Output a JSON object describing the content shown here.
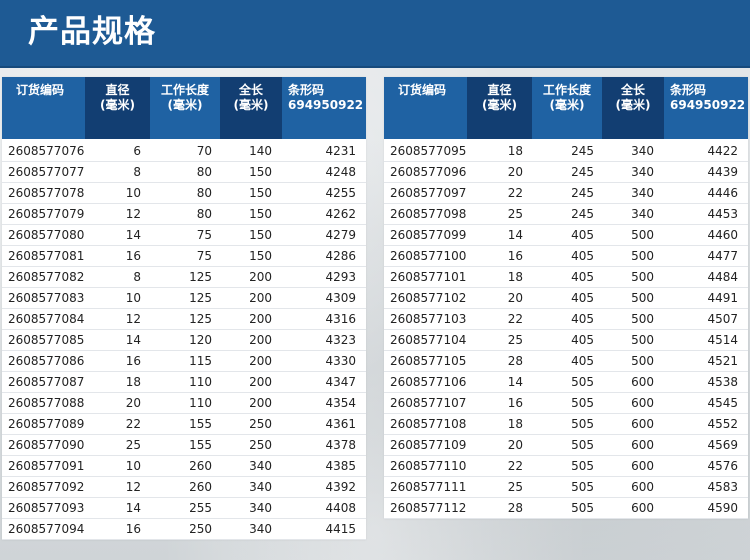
{
  "header": {
    "title": "产品规格"
  },
  "columns": {
    "order": "订货编码",
    "diameter": [
      "直径",
      "(毫米)"
    ],
    "work_length": [
      "工作长度",
      "(毫米)"
    ],
    "total_length": [
      "全长",
      "(毫米)"
    ],
    "barcode": [
      "条形码",
      "694950922"
    ]
  },
  "colors": {
    "header_bg": "#1e5a94",
    "col_light": "#1f62a3",
    "col_dark": "#123e72"
  },
  "tables": {
    "left": [
      [
        "2608577076",
        "6",
        "70",
        "140",
        "4231"
      ],
      [
        "2608577077",
        "8",
        "80",
        "150",
        "4248"
      ],
      [
        "2608577078",
        "10",
        "80",
        "150",
        "4255"
      ],
      [
        "2608577079",
        "12",
        "80",
        "150",
        "4262"
      ],
      [
        "2608577080",
        "14",
        "75",
        "150",
        "4279"
      ],
      [
        "2608577081",
        "16",
        "75",
        "150",
        "4286"
      ],
      [
        "2608577082",
        "8",
        "125",
        "200",
        "4293"
      ],
      [
        "2608577083",
        "10",
        "125",
        "200",
        "4309"
      ],
      [
        "2608577084",
        "12",
        "125",
        "200",
        "4316"
      ],
      [
        "2608577085",
        "14",
        "120",
        "200",
        "4323"
      ],
      [
        "2608577086",
        "16",
        "115",
        "200",
        "4330"
      ],
      [
        "2608577087",
        "18",
        "110",
        "200",
        "4347"
      ],
      [
        "2608577088",
        "20",
        "110",
        "200",
        "4354"
      ],
      [
        "2608577089",
        "22",
        "155",
        "250",
        "4361"
      ],
      [
        "2608577090",
        "25",
        "155",
        "250",
        "4378"
      ],
      [
        "2608577091",
        "10",
        "260",
        "340",
        "4385"
      ],
      [
        "2608577092",
        "12",
        "260",
        "340",
        "4392"
      ],
      [
        "2608577093",
        "14",
        "255",
        "340",
        "4408"
      ],
      [
        "2608577094",
        "16",
        "250",
        "340",
        "4415"
      ]
    ],
    "right": [
      [
        "2608577095",
        "18",
        "245",
        "340",
        "4422"
      ],
      [
        "2608577096",
        "20",
        "245",
        "340",
        "4439"
      ],
      [
        "2608577097",
        "22",
        "245",
        "340",
        "4446"
      ],
      [
        "2608577098",
        "25",
        "245",
        "340",
        "4453"
      ],
      [
        "2608577099",
        "14",
        "405",
        "500",
        "4460"
      ],
      [
        "2608577100",
        "16",
        "405",
        "500",
        "4477"
      ],
      [
        "2608577101",
        "18",
        "405",
        "500",
        "4484"
      ],
      [
        "2608577102",
        "20",
        "405",
        "500",
        "4491"
      ],
      [
        "2608577103",
        "22",
        "405",
        "500",
        "4507"
      ],
      [
        "2608577104",
        "25",
        "405",
        "500",
        "4514"
      ],
      [
        "2608577105",
        "28",
        "405",
        "500",
        "4521"
      ],
      [
        "2608577106",
        "14",
        "505",
        "600",
        "4538"
      ],
      [
        "2608577107",
        "16",
        "505",
        "600",
        "4545"
      ],
      [
        "2608577108",
        "18",
        "505",
        "600",
        "4552"
      ],
      [
        "2608577109",
        "20",
        "505",
        "600",
        "4569"
      ],
      [
        "2608577110",
        "22",
        "505",
        "600",
        "4576"
      ],
      [
        "2608577111",
        "25",
        "505",
        "600",
        "4583"
      ],
      [
        "2608577112",
        "28",
        "505",
        "600",
        "4590"
      ]
    ]
  }
}
